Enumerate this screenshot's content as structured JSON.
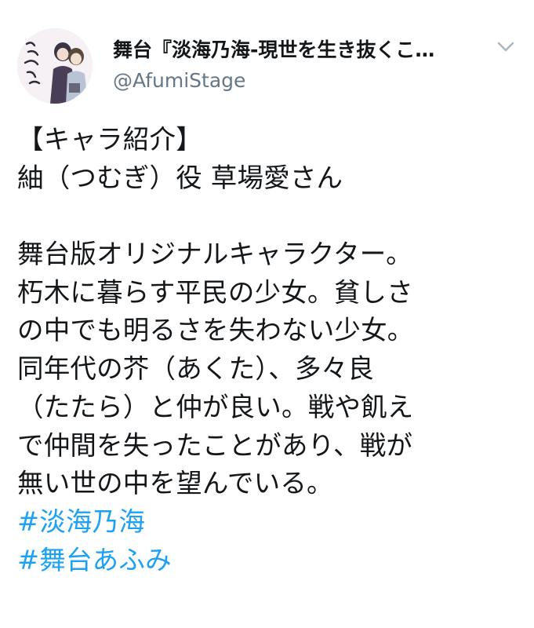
{
  "account": {
    "display_name": "舞台『淡海乃海-現世を生き抜くこ…",
    "handle": "@AfumiStage",
    "avatar_icon": "profile-avatar-icon"
  },
  "menu": {
    "caret_icon": "chevron-down-icon"
  },
  "tweet": {
    "lines": [
      "【キャラ紹介】",
      "紬（つむぎ）役 草場愛さん",
      "",
      "舞台版オリジナルキャラクター。",
      "朽木に暮らす平民の少女。貧しさ",
      "の中でも明るさを失わない少女。",
      "同年代の芥（あくた）、多々良",
      "（たたら）と仲が良い。戦や飢え",
      "で仲間を失ったことがあり、戦が",
      "無い世の中を望んでいる。"
    ],
    "hashtags": [
      "#淡海乃海",
      "#舞台あふみ"
    ]
  },
  "colors": {
    "text": "#14171a",
    "handle": "#657786",
    "hashtag": "#1da1f2",
    "caret": "#aab8c2"
  }
}
